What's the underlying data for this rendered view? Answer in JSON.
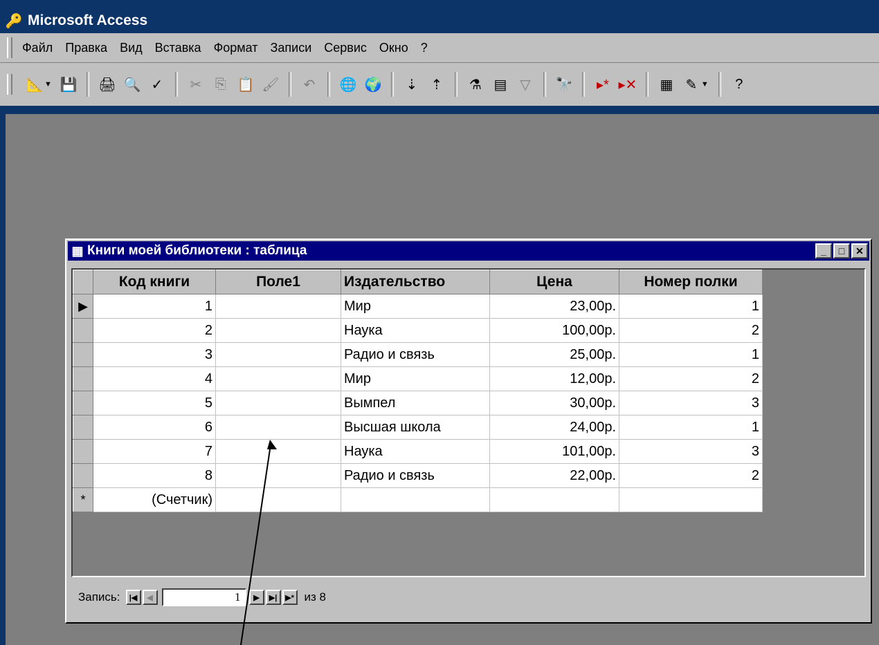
{
  "app": {
    "title": "Microsoft Access",
    "colors": {
      "desktop": "#0d3468",
      "workspace": "#7f7f7f",
      "active_title": "#000080"
    }
  },
  "menu": [
    {
      "label": "Файл"
    },
    {
      "label": "Правка"
    },
    {
      "label": "Вид"
    },
    {
      "label": "Вставка"
    },
    {
      "label": "Формат"
    },
    {
      "label": "Записи"
    },
    {
      "label": "Сервис"
    },
    {
      "label": "Окно"
    },
    {
      "label": "?"
    }
  ],
  "toolbar": {
    "icons": [
      "design-view-icon",
      "save-icon",
      "print-icon",
      "print-preview-icon",
      "spelling-icon",
      "cut-icon",
      "copy-icon",
      "paste-icon",
      "format-painter-icon",
      "undo-icon",
      "insert-hyperlink-icon",
      "web-toolbar-icon",
      "sort-ascending-icon",
      "sort-descending-icon",
      "filter-by-selection-icon",
      "filter-by-form-icon",
      "apply-filter-icon",
      "find-icon",
      "new-record-icon",
      "delete-record-icon",
      "database-window-icon",
      "new-object-icon",
      "help-icon"
    ]
  },
  "datasheet": {
    "title": "Книги моей библиотеки : таблица",
    "columns": [
      "Код книги",
      "Поле1",
      "Издательство",
      "Цена",
      "Номер полки"
    ],
    "rows": [
      [
        "1",
        "",
        "Мир",
        "23,00р.",
        "1"
      ],
      [
        "2",
        "",
        "Наука",
        "100,00р.",
        "2"
      ],
      [
        "3",
        "",
        "Радио и связь",
        "25,00р.",
        "1"
      ],
      [
        "4",
        "",
        "Мир",
        "12,00р.",
        "2"
      ],
      [
        "5",
        "",
        "Вымпел",
        "30,00р.",
        "3"
      ],
      [
        "6",
        "",
        "Высшая школа",
        "24,00р.",
        "1"
      ],
      [
        "7",
        "",
        "Наука",
        "101,00р.",
        "3"
      ],
      [
        "8",
        "",
        "Радио и связь",
        "22,00р.",
        "2"
      ]
    ],
    "new_row": [
      "(Счетчик)",
      "",
      "",
      "",
      ""
    ],
    "current_row_marker": "▶",
    "new_row_marker": "*"
  },
  "navigation": {
    "label": "Запись:",
    "current": "1",
    "of_text": "из 8"
  }
}
